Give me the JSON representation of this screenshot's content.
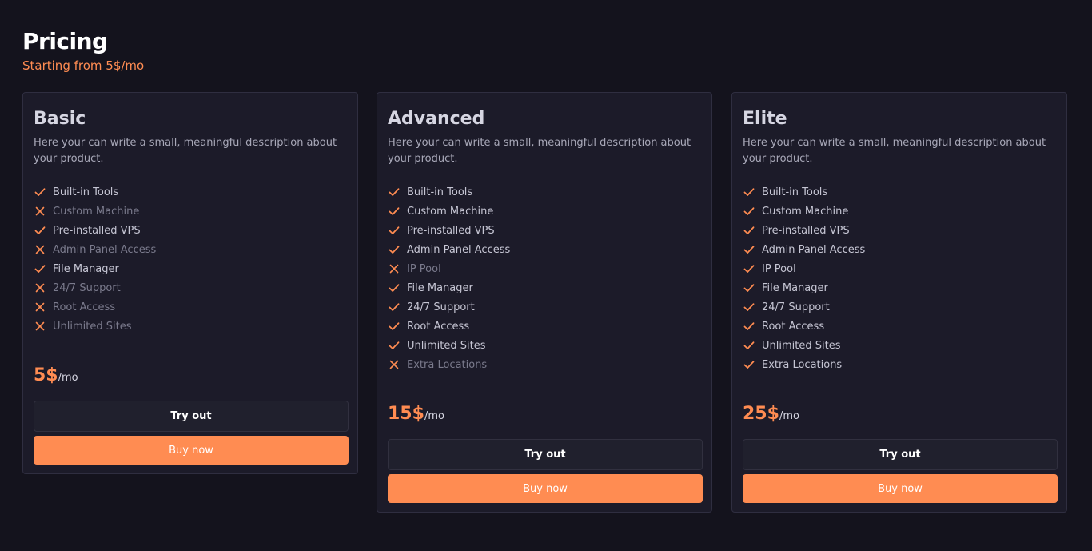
{
  "header": {
    "title": "Pricing",
    "subtitle": "Starting from 5$/mo"
  },
  "colors": {
    "background": "#14131d",
    "card": "#1c1b29",
    "accent": "#ff8c52",
    "check": "#ff8c52",
    "cross": "#ff8c52"
  },
  "icons": {
    "included": "check-icon",
    "excluded": "cross-icon"
  },
  "plans": [
    {
      "name": "Basic",
      "description": "Here your can write a small, meaningful description about your product.",
      "features": [
        {
          "label": "Built-in Tools",
          "included": true
        },
        {
          "label": "Custom Machine",
          "included": false
        },
        {
          "label": "Pre-installed VPS",
          "included": true
        },
        {
          "label": "Admin Panel Access",
          "included": false
        },
        {
          "label": "File Manager",
          "included": true
        },
        {
          "label": "24/7 Support",
          "included": false
        },
        {
          "label": "Root Access",
          "included": false
        },
        {
          "label": "Unlimited Sites",
          "included": false
        }
      ],
      "price": "5$",
      "period": "/mo",
      "try_label": "Try out",
      "buy_label": "Buy now"
    },
    {
      "name": "Advanced",
      "description": "Here your can write a small, meaningful description about your product.",
      "features": [
        {
          "label": "Built-in Tools",
          "included": true
        },
        {
          "label": "Custom Machine",
          "included": true
        },
        {
          "label": "Pre-installed VPS",
          "included": true
        },
        {
          "label": "Admin Panel Access",
          "included": true
        },
        {
          "label": "IP Pool",
          "included": false
        },
        {
          "label": "File Manager",
          "included": true
        },
        {
          "label": "24/7 Support",
          "included": true
        },
        {
          "label": "Root Access",
          "included": true
        },
        {
          "label": "Unlimited Sites",
          "included": true
        },
        {
          "label": "Extra Locations",
          "included": false
        }
      ],
      "price": "15$",
      "period": "/mo",
      "try_label": "Try out",
      "buy_label": "Buy now"
    },
    {
      "name": "Elite",
      "description": "Here your can write a small, meaningful description about your product.",
      "features": [
        {
          "label": "Built-in Tools",
          "included": true
        },
        {
          "label": "Custom Machine",
          "included": true
        },
        {
          "label": "Pre-installed VPS",
          "included": true
        },
        {
          "label": "Admin Panel Access",
          "included": true
        },
        {
          "label": "IP Pool",
          "included": true
        },
        {
          "label": "File Manager",
          "included": true
        },
        {
          "label": "24/7 Support",
          "included": true
        },
        {
          "label": "Root Access",
          "included": true
        },
        {
          "label": "Unlimited Sites",
          "included": true
        },
        {
          "label": "Extra Locations",
          "included": true
        }
      ],
      "price": "25$",
      "period": "/mo",
      "try_label": "Try out",
      "buy_label": "Buy now"
    }
  ]
}
